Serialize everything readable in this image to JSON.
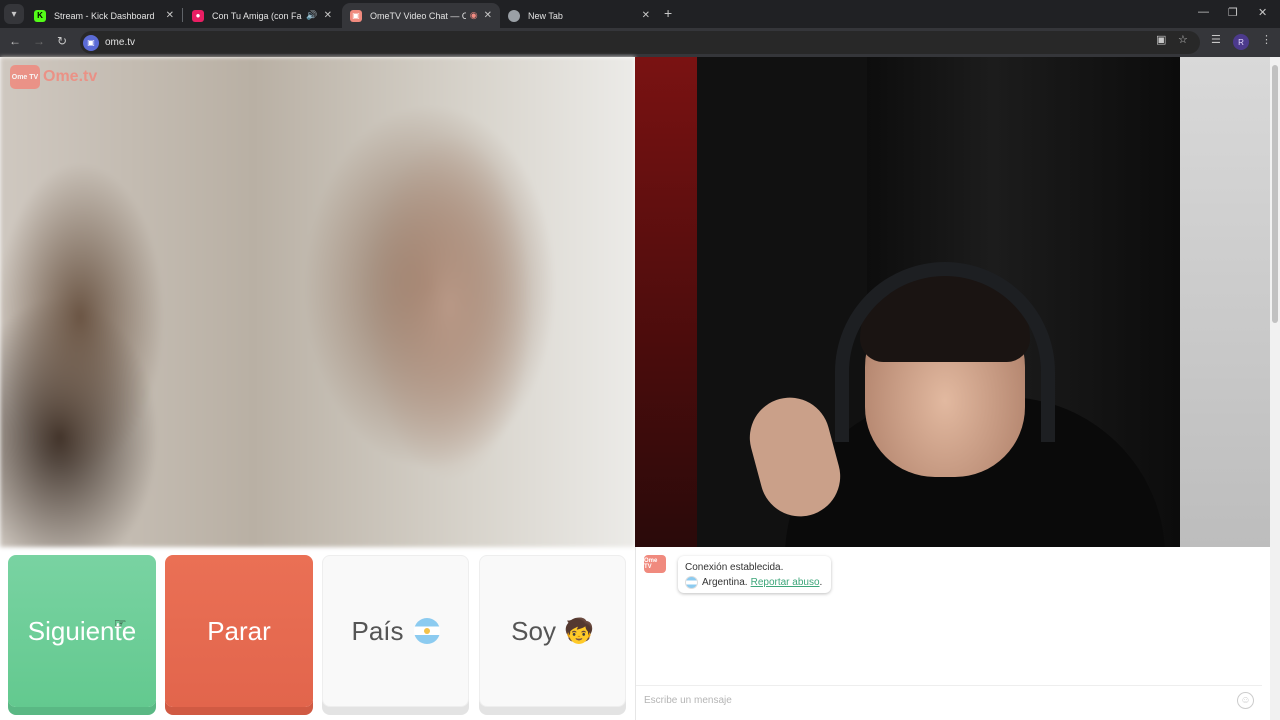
{
  "browser": {
    "tabs": [
      {
        "title": "Stream - Kick Dashboard",
        "favicon": "kick-icon",
        "color": "#53fc18",
        "active": false
      },
      {
        "title": "Con Tu Amiga (con Fauna",
        "favicon": "music-icon",
        "color": "#e91e63",
        "active": false,
        "extra": "🔊"
      },
      {
        "title": "OmeTV Video Chat — Ome",
        "favicon": "ometv-icon",
        "color": "#f08a7e",
        "active": true,
        "extra": "◉"
      },
      {
        "title": "New Tab",
        "favicon": "chrome-icon",
        "color": "#9aa0a6",
        "active": false
      }
    ],
    "url": "ome.tv",
    "profile_initial": "R"
  },
  "logo": {
    "box": "Ome TV",
    "text": "Ome.tv"
  },
  "controls": {
    "next_label": "Siguiente",
    "stop_label": "Parar",
    "country_label": "País",
    "soy_label": "Soy",
    "soy_emoji": "🧒"
  },
  "chat": {
    "logo": "Ome TV",
    "status": "Conexión establecida.",
    "country": "Argentina.",
    "report_link": "Reportar abuso",
    "report_suffix": ".",
    "input_placeholder": "Escribe un mensaje"
  },
  "colors": {
    "next": "#6bcd96",
    "stop": "#e66a50",
    "accent": "#f08a7e"
  }
}
